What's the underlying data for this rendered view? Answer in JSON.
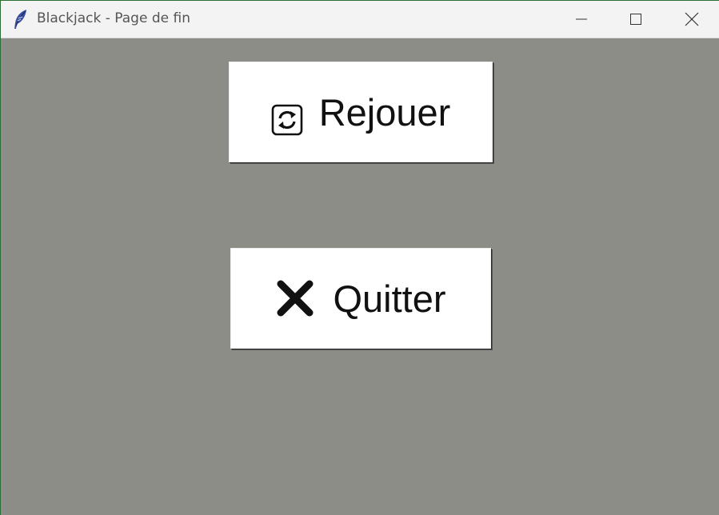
{
  "window": {
    "title": "Blackjack - Page de fin",
    "app_icon": "feather-icon",
    "controls": {
      "minimize_icon": "minimize-icon",
      "maximize_icon": "maximize-icon",
      "close_icon": "close-icon"
    },
    "background_color": "#8b8d86"
  },
  "buttons": {
    "replay": {
      "label": "Rejouer",
      "icon": "refresh-icon"
    },
    "quit": {
      "label": "Quitter",
      "icon": "x-icon"
    }
  }
}
